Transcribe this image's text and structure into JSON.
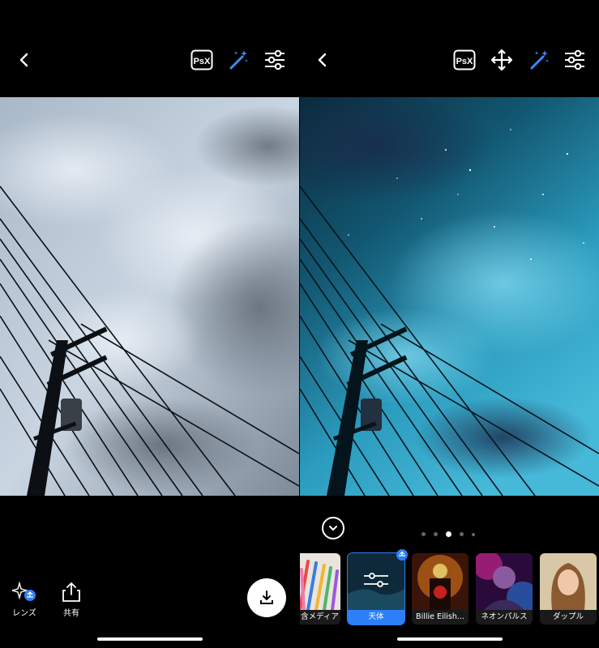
{
  "left_panel": {
    "toolbar": {
      "back_icon": "chevron-left-icon",
      "psx_label": "PsX",
      "magic_icon": "magic-wand-icon",
      "adjust_icon": "sliders-icon"
    },
    "bottom": {
      "lens_label": "レンズ",
      "share_label": "共有",
      "download_icon": "download-icon"
    }
  },
  "right_panel": {
    "toolbar": {
      "back_icon": "chevron-left-icon",
      "psx_label": "PsX",
      "move_icon": "move-arrows-icon",
      "magic_icon": "magic-wand-icon",
      "adjust_icon": "sliders-icon"
    },
    "carousel": {
      "page_count": 5,
      "active_index": 2
    },
    "lenses": [
      {
        "label": "含メディア",
        "selected": false
      },
      {
        "label": "天体",
        "selected": true
      },
      {
        "label": "Billie Eilish...",
        "selected": false
      },
      {
        "label": "ネオンパルス",
        "selected": false
      },
      {
        "label": "ダップル",
        "selected": false
      }
    ]
  },
  "colors": {
    "accent": "#2d7ff9",
    "magic_wand": "#3b8cff",
    "background": "#000000"
  }
}
